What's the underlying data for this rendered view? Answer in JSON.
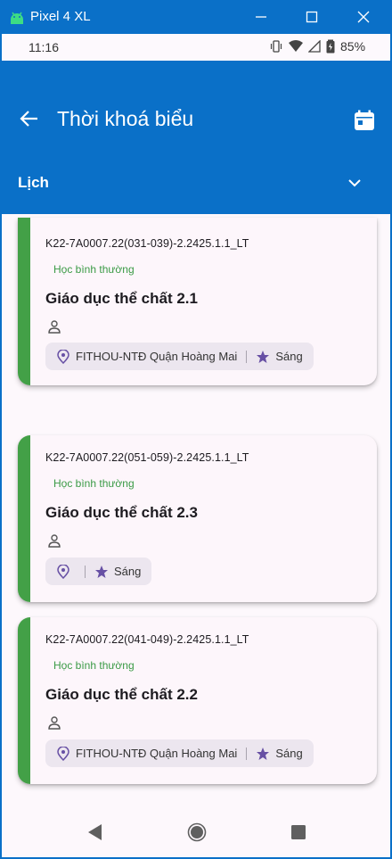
{
  "window": {
    "title": "Pixel 4 XL",
    "icon": "android-icon",
    "controls": [
      "minimize-icon",
      "maximize-icon",
      "close-icon"
    ]
  },
  "statusbar": {
    "time": "11:16",
    "battery": "85%",
    "icons": [
      "vibrate-icon",
      "wifi-icon",
      "signal-icon",
      "battery-charging-icon"
    ]
  },
  "appbar": {
    "title": "Thời khoá biểu",
    "back_icon": "arrow-back-icon",
    "calendar_icon": "calendar-icon",
    "color": "#0a70c8"
  },
  "dropdown": {
    "label": "Lịch",
    "icon": "chevron-down-icon"
  },
  "cards": [
    {
      "code": "K22-7A0007.22(031-039)-2.2425.1.1_LT",
      "status": "Học bình thường",
      "subject": "Giáo dục thể chất 2.1",
      "location": "FITHOU-NTĐ Quận Hoàng Mai",
      "session": "Sáng"
    },
    {
      "code": "K22-7A0007.22(051-059)-2.2425.1.1_LT",
      "status": "Học bình thường",
      "subject": "Giáo dục thể chất 2.3",
      "location": "",
      "session": "Sáng"
    },
    {
      "code": "K22-7A0007.22(041-049)-2.2425.1.1_LT",
      "status": "Học bình thường",
      "subject": "Giáo dục thể chất 2.2",
      "location": "FITHOU-NTĐ Quận Hoàng Mai",
      "session": "Sáng"
    }
  ],
  "colors": {
    "accent_green": "#43a047",
    "status_green": "#3a9a45",
    "icon_purple": "#6750a4"
  },
  "navbar": {
    "icons": [
      "nav-back-icon",
      "nav-home-icon",
      "nav-recent-icon"
    ]
  }
}
